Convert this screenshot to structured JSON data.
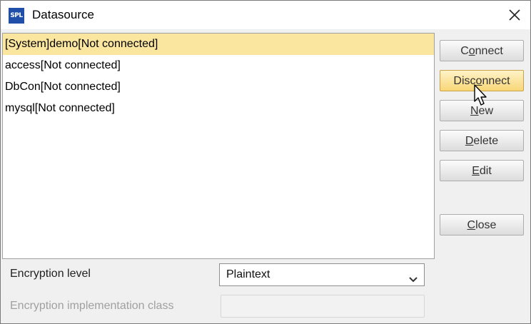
{
  "window": {
    "title": "Datasource",
    "app_icon_text": "SPL"
  },
  "datasources": [
    {
      "label": "[System]demo[Not connected]",
      "selected": true
    },
    {
      "label": "access[Not connected]",
      "selected": false
    },
    {
      "label": "DbCon[Not connected]",
      "selected": false
    },
    {
      "label": "mysql[Not connected]",
      "selected": false
    }
  ],
  "buttons": {
    "connect": {
      "pre": "C",
      "ul": "o",
      "post": "nnect"
    },
    "disconnect": {
      "pre": "Disc",
      "ul": "o",
      "post": "nnect"
    },
    "new": {
      "pre": "",
      "ul": "N",
      "post": "ew"
    },
    "delete": {
      "pre": "",
      "ul": "D",
      "post": "elete"
    },
    "edit": {
      "pre": "",
      "ul": "E",
      "post": "dit"
    },
    "close": {
      "pre": "",
      "ul": "C",
      "post": "lose"
    }
  },
  "encryption": {
    "level_label": "Encryption level",
    "level_value": "Plaintext",
    "class_label": "Encryption implementation class",
    "class_value": ""
  },
  "colors": {
    "selection": "#fbe6a0",
    "hover_button": "#f8d777",
    "app_icon": "#1f4fa8"
  },
  "icons": {
    "app": "spl-logo-icon",
    "close": "close-icon",
    "dropdown": "chevron-down-icon",
    "cursor": "mouse-pointer-icon"
  }
}
